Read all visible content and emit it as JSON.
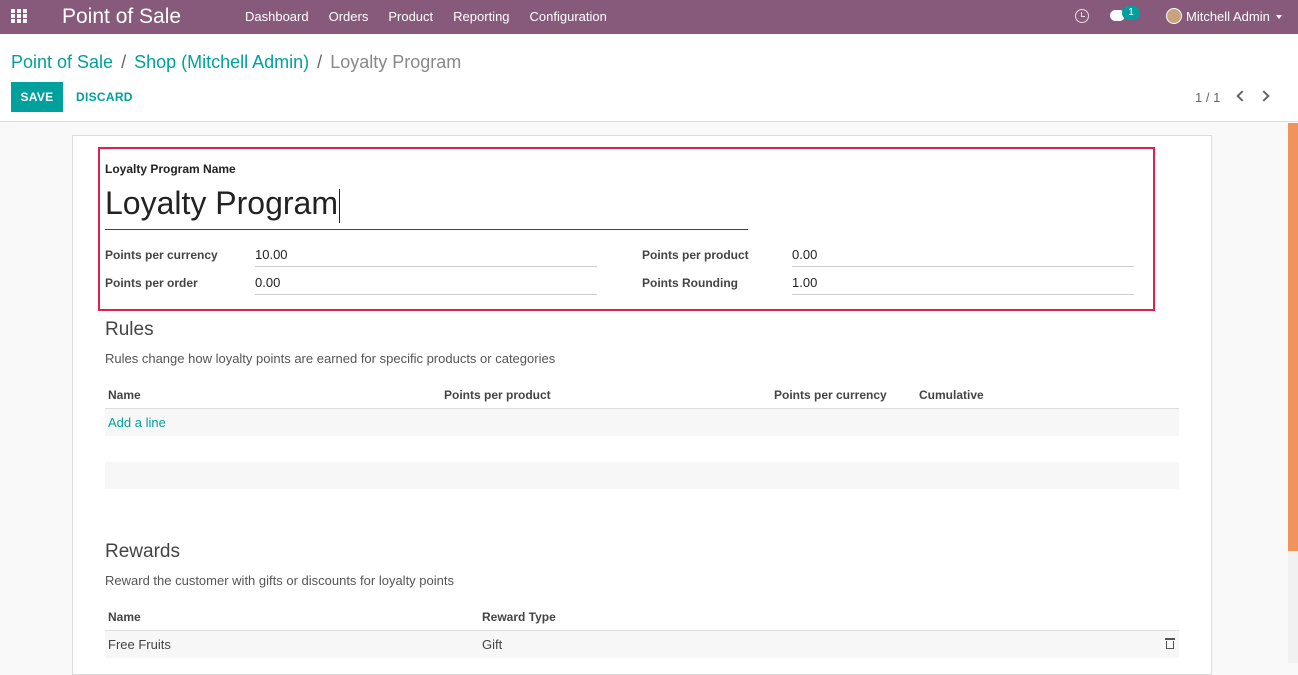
{
  "navbar": {
    "brand": "Point of Sale",
    "menu": [
      "Dashboard",
      "Orders",
      "Product",
      "Reporting",
      "Configuration"
    ],
    "chat_count": "1",
    "user": "Mitchell Admin",
    "bg_color": "#875a7b"
  },
  "breadcrumb": {
    "items": [
      "Point of Sale",
      "Shop (Mitchell Admin)"
    ],
    "current": "Loyalty Program",
    "separator": "/"
  },
  "toolbar": {
    "save_label": "SAVE",
    "discard_label": "DISCARD",
    "pager": "1 / 1",
    "accent_color": "#00a09d"
  },
  "form": {
    "name_label": "Loyalty Program Name",
    "name_value": "Loyalty Program",
    "fields": {
      "points_per_currency": {
        "label": "Points per currency",
        "value": "10.00"
      },
      "points_per_order": {
        "label": "Points per order",
        "value": "0.00"
      },
      "points_per_product": {
        "label": "Points per product",
        "value": "0.00"
      },
      "points_rounding": {
        "label": "Points Rounding",
        "value": "1.00"
      }
    }
  },
  "rules": {
    "title": "Rules",
    "description": "Rules change how loyalty points are earned for specific products or categories",
    "columns": [
      "Name",
      "Points per product",
      "Points per currency",
      "Cumulative"
    ],
    "add_line": "Add a line"
  },
  "rewards": {
    "title": "Rewards",
    "description": "Reward the customer with gifts or discounts for loyalty points",
    "columns": [
      "Name",
      "Reward Type"
    ],
    "rows": [
      {
        "name": "Free Fruits",
        "reward_type": "Gift"
      }
    ]
  },
  "highlight_color": "#e0214e"
}
